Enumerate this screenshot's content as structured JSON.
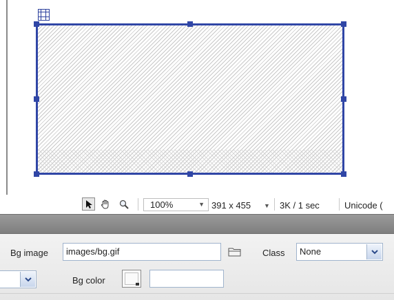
{
  "status_bar": {
    "zoom": "100%",
    "dimensions": "391 x 455",
    "download_speed": "3K / 1 sec",
    "encoding": "Unicode ("
  },
  "properties": {
    "bg_image_label": "Bg image",
    "bg_image_value": "images/bg.gif",
    "class_label": "Class",
    "class_value": "None",
    "bg_color_label": "Bg color",
    "bg_color_value": ""
  },
  "icons": [
    "table-icon",
    "pointer-icon",
    "hand-icon",
    "zoom-icon",
    "chevron-down-icon",
    "folder-icon",
    "color-picker-icon"
  ],
  "colors": {
    "selection": "#3046a6",
    "panel_header": "#8c8c8c",
    "panel_body": "#ececec"
  }
}
